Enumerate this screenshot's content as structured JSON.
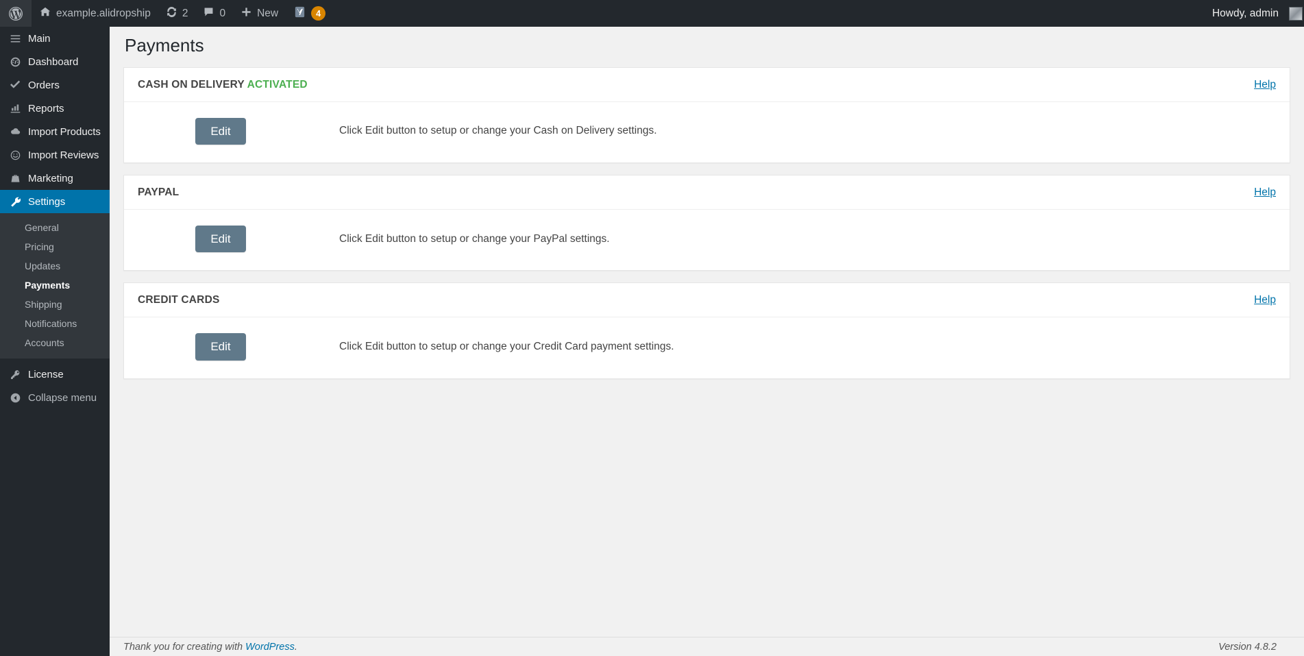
{
  "adminbar": {
    "wp_logo": "wordpress-logo-icon",
    "site_name": "example.alidropship",
    "updates": {
      "icon": "updates-icon",
      "count": "2"
    },
    "comments": {
      "icon": "comment-bubble-icon",
      "count": "0"
    },
    "new": {
      "icon": "plus-icon",
      "label": "New"
    },
    "yoast": {
      "icon": "yoast-seo-icon",
      "badge": "4"
    },
    "howdy": "Howdy, admin"
  },
  "sidebar": {
    "items": [
      {
        "label": "Main",
        "icon": "menu-hamburger-icon",
        "current": false
      },
      {
        "label": "Dashboard",
        "icon": "dashboard-gauge-icon",
        "current": false
      },
      {
        "label": "Orders",
        "icon": "checkmark-icon",
        "current": false
      },
      {
        "label": "Reports",
        "icon": "chart-bar-icon",
        "current": false
      },
      {
        "label": "Import Products",
        "icon": "cloud-icon",
        "current": false
      },
      {
        "label": "Import Reviews",
        "icon": "smiley-face-icon",
        "current": false
      },
      {
        "label": "Marketing",
        "icon": "briefcase-icon",
        "current": false
      },
      {
        "label": "Settings",
        "icon": "wrench-icon",
        "current": true
      }
    ],
    "submenu": [
      {
        "label": "General",
        "current": false
      },
      {
        "label": "Pricing",
        "current": false
      },
      {
        "label": "Updates",
        "current": false
      },
      {
        "label": "Payments",
        "current": true
      },
      {
        "label": "Shipping",
        "current": false
      },
      {
        "label": "Notifications",
        "current": false
      },
      {
        "label": "Accounts",
        "current": false
      }
    ],
    "license": {
      "label": "License",
      "icon": "key-icon"
    },
    "collapse": {
      "label": "Collapse menu",
      "icon": "arrow-left-circle-icon"
    }
  },
  "page": {
    "title": "Payments",
    "help_label": "Help"
  },
  "panels": [
    {
      "title": "CASH ON DELIVERY",
      "status": "ACTIVATED",
      "help": "Help",
      "button": "Edit",
      "description": "Click Edit button to setup or change your Cash on Delivery settings."
    },
    {
      "title": "PAYPAL",
      "status": "",
      "help": "Help",
      "button": "Edit",
      "description": "Click Edit button to setup or change your PayPal settings."
    },
    {
      "title": "CREDIT CARDS",
      "status": "",
      "help": "Help",
      "button": "Edit",
      "description": "Click Edit button to setup or change your Credit Card payment settings."
    }
  ],
  "footer": {
    "thanks_prefix": "Thank you for creating with ",
    "wordpress_link": "WordPress",
    "thanks_suffix": ".",
    "version": "Version 4.8.2"
  },
  "colors": {
    "admin_dark": "#23282d",
    "submenu_bg": "#32373c",
    "accent_blue": "#0073aa",
    "link_blue": "#0073aa",
    "activated_green": "#4caf50",
    "button_slate": "#60798a",
    "badge_orange": "#d98500"
  }
}
